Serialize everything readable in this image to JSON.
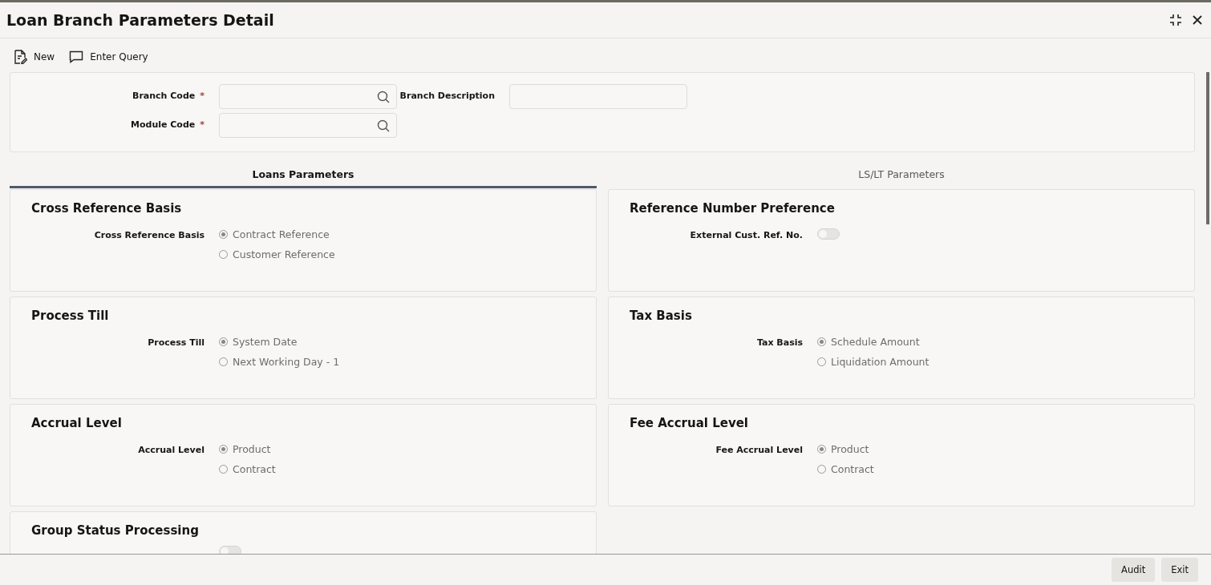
{
  "window": {
    "title": "Loan Branch Parameters Detail"
  },
  "toolbar": [
    {
      "kind": "new",
      "label": "New"
    },
    {
      "kind": "query",
      "label": "Enter Query"
    }
  ],
  "form": {
    "fields": [
      {
        "label": "Branch Code",
        "required": "*",
        "lookup": true
      },
      {
        "label": "Branch Description",
        "lookup": false
      },
      {
        "label": "Module Code",
        "required": "*",
        "lookup": true
      }
    ]
  },
  "tabs": [
    {
      "label": "Loans Parameters",
      "selected": true
    },
    {
      "label": "LS/LT Parameters",
      "selected": false
    }
  ],
  "sections": [
    {
      "title": "Cross Reference Basis",
      "kind": "radio",
      "label": "Cross Reference Basis",
      "options": [
        {
          "label": "Contract Reference",
          "selected": true
        },
        {
          "label": "Customer Reference",
          "selected": false
        }
      ]
    },
    {
      "title": "Reference Number Preference",
      "kind": "toggle",
      "label": "External Cust. Ref. No.",
      "on": false
    },
    {
      "title": "Process Till",
      "kind": "radio",
      "label": "Process Till",
      "options": [
        {
          "label": "System Date",
          "selected": true
        },
        {
          "label": "Next Working Day - 1",
          "selected": false
        }
      ]
    },
    {
      "title": "Tax Basis",
      "kind": "radio",
      "label": "Tax Basis",
      "options": [
        {
          "label": "Schedule Amount",
          "selected": true
        },
        {
          "label": "Liquidation Amount",
          "selected": false
        }
      ]
    },
    {
      "title": "Accrual Level",
      "kind": "radio",
      "label": "Accrual Level",
      "options": [
        {
          "label": "Product",
          "selected": true
        },
        {
          "label": "Contract",
          "selected": false
        }
      ]
    },
    {
      "title": "Fee Accrual Level",
      "kind": "radio",
      "label": "Fee Accrual Level",
      "options": [
        {
          "label": "Product",
          "selected": true
        },
        {
          "label": "Contract",
          "selected": false
        }
      ]
    },
    {
      "title": "Group Status Processing",
      "kind": "toggle",
      "on": false
    }
  ],
  "footer": {
    "buttons": [
      "Audit",
      "Exit"
    ]
  }
}
